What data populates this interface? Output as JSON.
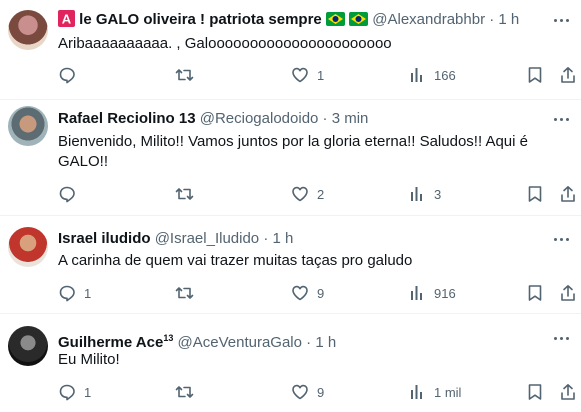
{
  "replies": [
    {
      "name": "le GALO oliveira ! patriota sempre",
      "name_prefix_icon": "red-a-square-icon",
      "name_suffix_icons": [
        "brazil-flag-icon",
        "brazil-flag-icon"
      ],
      "handle": "@Alexandrabhbr",
      "sep": "·",
      "time": "1 h",
      "text": "Aribaaaaaaaaaa. , Galoooooooooooooooooooooo",
      "stats": {
        "reply": "",
        "retweet": "",
        "like": "1",
        "views": "166"
      }
    },
    {
      "name": "Rafael Reciolino 13",
      "handle": "@Reciogalodoido",
      "sep": "·",
      "time": "3 min",
      "text": "Bienvenido, Milito!! Vamos juntos por la gloria eterna!! Saludos!! Aqui é GALO!!",
      "stats": {
        "reply": "",
        "retweet": "",
        "like": "2",
        "views": "3"
      }
    },
    {
      "name": "Israel iludido",
      "handle": "@Israel_Iludido",
      "sep": "·",
      "time": "1 h",
      "text": "A carinha de quem vai trazer muitas taças pro galudo",
      "stats": {
        "reply": "1",
        "retweet": "",
        "like": "9",
        "views": "916"
      }
    },
    {
      "name": "Guilherme Ace",
      "name_superscript": "13",
      "handle": "@AceVenturaGalo",
      "sep": "·",
      "time": "1 h",
      "text": "Eu Milito!",
      "stats": {
        "reply": "1",
        "retweet": "",
        "like": "9",
        "views": "1 mil"
      }
    }
  ],
  "colors": {
    "text": "#0f1419",
    "muted": "#536471",
    "border": "#eff3f4",
    "flag_green": "#009c3b",
    "flag_yellow": "#ffdf00",
    "flag_blue": "#002776",
    "icon_red": "#e0245e"
  }
}
